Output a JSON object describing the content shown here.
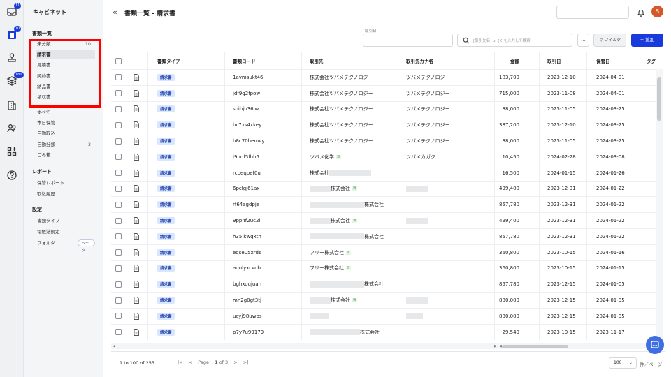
{
  "rail": {
    "badges": [
      "11",
      "10",
      "180"
    ]
  },
  "sidebar": {
    "brand": "キャビネット",
    "sections": {
      "docs": "書類一覧",
      "report": "レポート",
      "settings": "設定"
    },
    "doc_items": [
      {
        "label": "未分類",
        "count": "10"
      },
      {
        "label": "請求書",
        "count": ""
      },
      {
        "label": "見積書",
        "count": ""
      },
      {
        "label": "契約書",
        "count": ""
      },
      {
        "label": "納品書",
        "count": ""
      },
      {
        "label": "領収書",
        "count": ""
      }
    ],
    "misc_items": [
      {
        "label": "すべて",
        "count": ""
      },
      {
        "label": "本日保管",
        "count": ""
      },
      {
        "label": "自動取込",
        "count": ""
      },
      {
        "label": "自動分類",
        "count": "3"
      },
      {
        "label": "ごみ箱",
        "count": ""
      }
    ],
    "report_items": [
      "保管レポート",
      "取込履歴"
    ],
    "settings_items": [
      "書類タイプ",
      "電帳法規定",
      "フォルダ"
    ],
    "beta": "ベータ"
  },
  "header": {
    "title": "書類一覧 - 請求書",
    "avatar": "S"
  },
  "filters": {
    "torihikibi_label": "取引日",
    "search_placeholder": "[取引先名] or [K]を入力して検索",
    "more": "...",
    "filter_btn": "フィルタ",
    "add_btn": "+ 追加"
  },
  "table": {
    "headers": [
      "書類タイプ",
      "書類コード",
      "取引先",
      "取引先カナ名",
      "金額",
      "取引日",
      "保管日",
      "タグ"
    ],
    "rows": [
      {
        "type": "請求書",
        "code": "1avmsukt46",
        "vendor": "株式会社ツバメテクノロジー",
        "kana": "ツバメテクノロジー",
        "amount": "183,700",
        "tdate": "2023-12-10",
        "sdate": "2024-04-01"
      },
      {
        "type": "請求書",
        "code": "jdf9g2fpow",
        "vendor": "株式会社ツバメテクノロジー",
        "kana": "ツバメテクノロジー",
        "amount": "715,000",
        "tdate": "2023-11-08",
        "sdate": "2024-04-01"
      },
      {
        "type": "請求書",
        "code": "soihjh36iw",
        "vendor": "株式会社ツバメテクノロジー",
        "kana": "ツバメテクノロジー",
        "amount": "88,000",
        "tdate": "2023-11-05",
        "sdate": "2024-03-25"
      },
      {
        "type": "請求書",
        "code": "bc7xs4xkey",
        "vendor": "株式会社ツバメテクノロジー",
        "kana": "ツバメテクノロジー",
        "amount": "387,200",
        "tdate": "2023-12-10",
        "sdate": "2024-03-25"
      },
      {
        "type": "請求書",
        "code": "b8c70hemvy",
        "vendor": "株式会社ツバメテクノロジー",
        "kana": "ツバメテクノロジー",
        "amount": "88,000",
        "tdate": "2023-11-05",
        "sdate": "2024-03-25"
      },
      {
        "type": "請求書",
        "code": "i9hdf5fhh5",
        "vendor": "ツバメ化学",
        "badge": "済",
        "kana": "ツバメカガク",
        "amount": "10,450",
        "tdate": "2024-02-28",
        "sdate": "2024-03-08"
      },
      {
        "type": "請求書",
        "code": "rcbeqpef0u",
        "vendor": "株式会社",
        "blur_after": 60,
        "amount": "16,500",
        "tdate": "2024-01-15",
        "sdate": "2024-01-26"
      },
      {
        "type": "請求書",
        "code": "6pclgj61ax",
        "vendor": "株式会社",
        "blur_before": 30,
        "badge": "済",
        "kana_blur": 32,
        "amount": "499,400",
        "tdate": "2023-12-31",
        "sdate": "2024-01-22"
      },
      {
        "type": "請求書",
        "code": "rf64agdpje",
        "vendor": "株式会社",
        "blur_before": 78,
        "amount": "857,780",
        "tdate": "2023-12-31",
        "sdate": "2024-01-22"
      },
      {
        "type": "請求書",
        "code": "9pp4f2uc2i",
        "vendor": "株式会社",
        "blur_before": 30,
        "badge": "済",
        "kana_blur": 32,
        "amount": "499,400",
        "tdate": "2023-12-31",
        "sdate": "2024-01-22"
      },
      {
        "type": "請求書",
        "code": "h35lkwqxtn",
        "vendor": "株式会社",
        "blur_before": 78,
        "amount": "857,780",
        "tdate": "2023-12-31",
        "sdate": "2024-01-22"
      },
      {
        "type": "請求書",
        "code": "eqse05xrd6",
        "vendor": "フリー株式会社",
        "badge": "済",
        "amount": "360,800",
        "tdate": "2023-10-15",
        "sdate": "2024-01-16"
      },
      {
        "type": "請求書",
        "code": "aqulyxcvob",
        "vendor": "フリー株式会社",
        "badge": "済",
        "amount": "360,800",
        "tdate": "2023-10-15",
        "sdate": "2024-01-15"
      },
      {
        "type": "請求書",
        "code": "bghxoujuah",
        "vendor": "株式会社",
        "blur_before": 78,
        "amount": "857,780",
        "tdate": "2023-12-15",
        "sdate": "2024-01-05"
      },
      {
        "type": "請求書",
        "code": "mn2g0gt3tj",
        "vendor": "株式会社",
        "blur_before": 30,
        "badge": "済",
        "kana_blur": 32,
        "amount": "880,000",
        "tdate": "2023-12-15",
        "sdate": "2024-01-05"
      },
      {
        "type": "請求書",
        "code": "ucyj98uwps",
        "vendor": "",
        "blur_before": 28,
        "kana_blur": 24,
        "amount": "880,000",
        "tdate": "2023-12-15",
        "sdate": "2024-01-05"
      },
      {
        "type": "請求書",
        "code": "p7y7u99179",
        "vendor": "株式会社",
        "blur_before": 72,
        "amount": "29,540",
        "tdate": "2023-10-15",
        "sdate": "2023-11-17"
      }
    ]
  },
  "footer": {
    "range": "1 to 100 of 253",
    "page_prefix": "Page",
    "page_num": "1",
    "page_of": "of 3",
    "per_page": "100",
    "per_page_label": "件／ページ"
  },
  "colors": {
    "accent": "#1a3bdc",
    "highlight": "#ff0000",
    "avatar": "#d5582b"
  }
}
